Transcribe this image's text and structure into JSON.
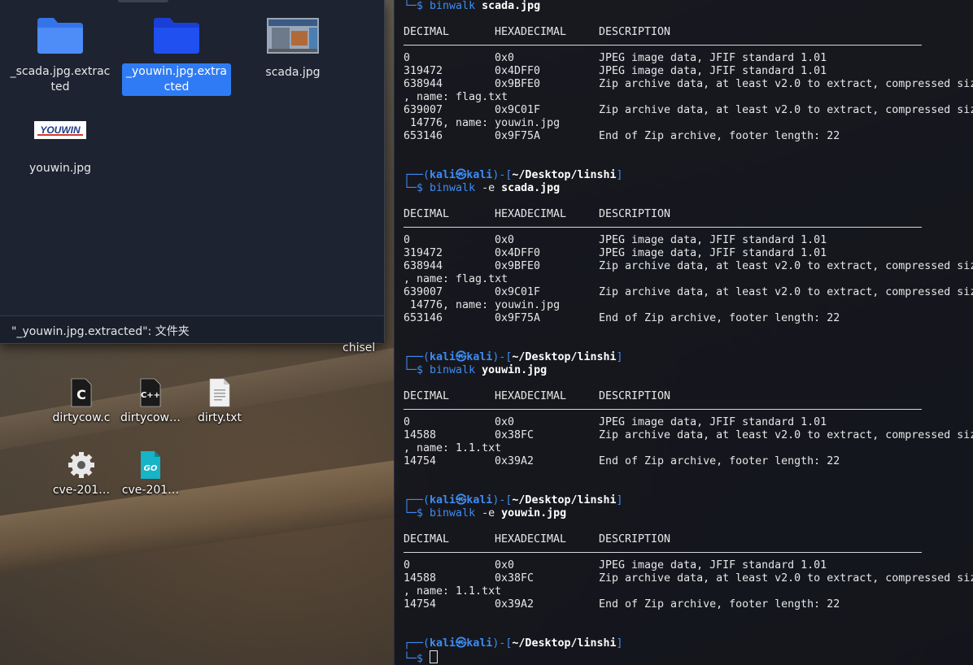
{
  "file_manager": {
    "items": [
      {
        "name": "_scada.jpg.extracted",
        "icon": "folder-icon",
        "selected": false
      },
      {
        "name": "_youwin.jpg.extracted",
        "icon": "folder-icon",
        "selected": true
      },
      {
        "name": "scada.jpg",
        "icon": "image-thumbnail",
        "selected": false
      },
      {
        "name": "youwin.jpg",
        "icon": "image-thumbnail",
        "selected": false
      }
    ],
    "status_text": "\"_youwin.jpg.extracted\": 文件夹",
    "youwin_thumb_text": "YOUWIN"
  },
  "desktop": {
    "items": [
      {
        "name": "dirtycow.c",
        "icon": "c-source-icon"
      },
      {
        "name": "dirtycow…",
        "icon": "cpp-source-icon"
      },
      {
        "name": "dirty.txt",
        "icon": "text-file-icon"
      },
      {
        "name": "cve-201…",
        "icon": "gear-icon"
      },
      {
        "name": "cve-201…",
        "icon": "go-file-icon"
      }
    ],
    "chisel_label": "chisel",
    "c_glyph": "C",
    "cpp_glyph": "C++",
    "go_glyph": "GO"
  },
  "terminal": {
    "prompt": {
      "user": "kali",
      "at": "㉿",
      "host": "kali",
      "path": "~/Desktop/linshi",
      "open": "┌──(",
      "close": ")-[",
      "end": "]",
      "cmd_prefix": "└─$ "
    },
    "header": {
      "decimal": "DECIMAL",
      "hex": "HEXADECIMAL",
      "desc": "DESCRIPTION"
    },
    "blocks": [
      {
        "command": "binwalk",
        "flag": "",
        "file": "scada.jpg",
        "rows": [
          {
            "dec": "0",
            "hex": "0x0",
            "desc": "JPEG image data, JFIF standard 1.01"
          },
          {
            "dec": "319472",
            "hex": "0x4DFF0",
            "desc": "JPEG image data, JFIF standard 1.01"
          },
          {
            "dec": "638944",
            "hex": "0x9BFE0",
            "desc": "Zip archive data, at least v2.0 to extract, compressed siz",
            "wrap": ", name: flag.txt"
          },
          {
            "dec": "639007",
            "hex": "0x9C01F",
            "desc": "Zip archive data, at least v2.0 to extract, compressed siz",
            "wrap": " 14776, name: youwin.jpg"
          },
          {
            "dec": "653146",
            "hex": "0x9F75A",
            "desc": "End of Zip archive, footer length: 22"
          }
        ]
      },
      {
        "command": "binwalk",
        "flag": "-e",
        "file": "scada.jpg",
        "rows": [
          {
            "dec": "0",
            "hex": "0x0",
            "desc": "JPEG image data, JFIF standard 1.01"
          },
          {
            "dec": "319472",
            "hex": "0x4DFF0",
            "desc": "JPEG image data, JFIF standard 1.01"
          },
          {
            "dec": "638944",
            "hex": "0x9BFE0",
            "desc": "Zip archive data, at least v2.0 to extract, compressed siz",
            "wrap": ", name: flag.txt"
          },
          {
            "dec": "639007",
            "hex": "0x9C01F",
            "desc": "Zip archive data, at least v2.0 to extract, compressed siz",
            "wrap": " 14776, name: youwin.jpg"
          },
          {
            "dec": "653146",
            "hex": "0x9F75A",
            "desc": "End of Zip archive, footer length: 22"
          }
        ]
      },
      {
        "command": "binwalk",
        "flag": "",
        "file": "youwin.jpg",
        "rows": [
          {
            "dec": "0",
            "hex": "0x0",
            "desc": "JPEG image data, JFIF standard 1.01"
          },
          {
            "dec": "14588",
            "hex": "0x38FC",
            "desc": "Zip archive data, at least v2.0 to extract, compressed siz",
            "wrap": ", name: 1.1.txt"
          },
          {
            "dec": "14754",
            "hex": "0x39A2",
            "desc": "End of Zip archive, footer length: 22"
          }
        ]
      },
      {
        "command": "binwalk",
        "flag": "-e",
        "file": "youwin.jpg",
        "rows": [
          {
            "dec": "0",
            "hex": "0x0",
            "desc": "JPEG image data, JFIF standard 1.01"
          },
          {
            "dec": "14588",
            "hex": "0x38FC",
            "desc": "Zip archive data, at least v2.0 to extract, compressed siz",
            "wrap": ", name: 1.1.txt"
          },
          {
            "dec": "14754",
            "hex": "0x39A2",
            "desc": "End of Zip archive, footer length: 22"
          }
        ]
      }
    ]
  },
  "colors": {
    "prompt_blue": "#3f8cf2",
    "selection_blue": "#2f7bf5",
    "terminal_bg": "#12141c",
    "folder_blue": "#2f7bf5"
  }
}
